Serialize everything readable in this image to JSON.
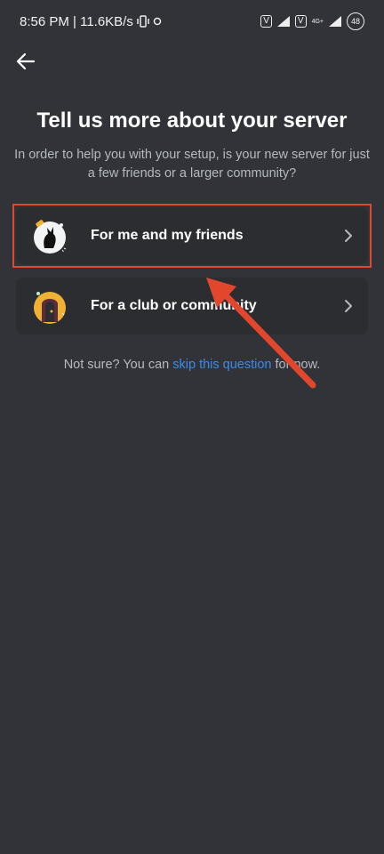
{
  "status_bar": {
    "time_net": "8:56 PM | 11.6KB/s",
    "sim1": "V",
    "sim2": "V",
    "net_type": "4G+",
    "battery": "48"
  },
  "header": {
    "title": "Tell us more about your server",
    "subtitle": "In order to help you with your setup, is your new server for just a few friends or a larger community?"
  },
  "options": [
    {
      "label": "For me and my friends",
      "icon": "friends-icon"
    },
    {
      "label": "For a club or community",
      "icon": "club-icon"
    }
  ],
  "skip": {
    "prefix": "Not sure? You can ",
    "link": "skip this question",
    "suffix": " for now."
  },
  "colors": {
    "background": "#313338",
    "card": "#2b2d31",
    "link": "#3b8ce8",
    "annotation": "#e2472d"
  }
}
